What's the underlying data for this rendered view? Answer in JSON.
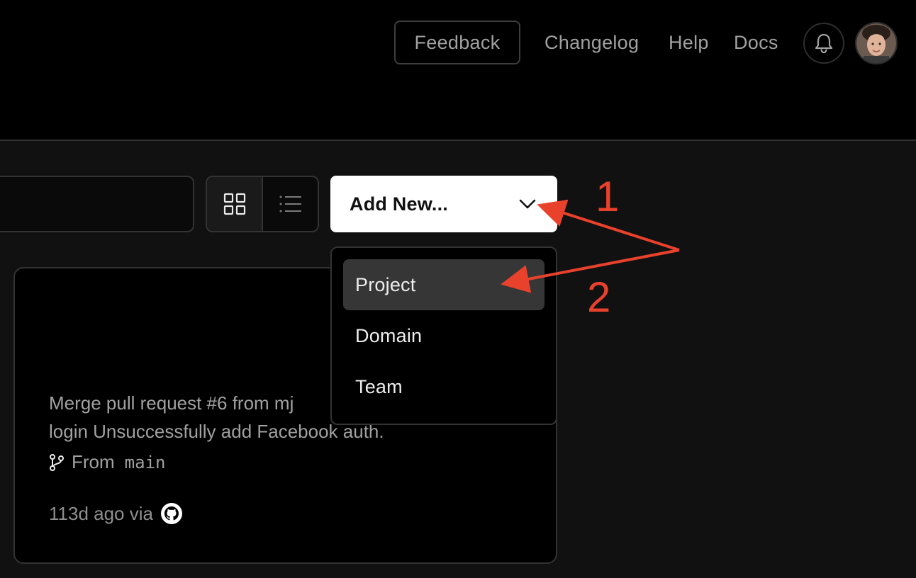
{
  "header": {
    "feedback_label": "Feedback",
    "nav_links": [
      "Changelog",
      "Help",
      "Docs"
    ],
    "notifications_icon": "bell-icon",
    "avatar_icon": "user-avatar"
  },
  "toolbar": {
    "view_toggle": [
      {
        "icon": "grid-icon",
        "active": true
      },
      {
        "icon": "list-icon",
        "active": false
      }
    ],
    "add_new_label": "Add New...",
    "add_new_icon": "chevron-down-icon"
  },
  "dropdown": {
    "items": [
      {
        "label": "Project",
        "highlighted": true
      },
      {
        "label": "Domain",
        "highlighted": false
      },
      {
        "label": "Team",
        "highlighted": false
      }
    ]
  },
  "project_card": {
    "commit_line1": "Merge pull request #6 from mj",
    "commit_line2": "login Unsuccessfully add Facebook auth.",
    "branch_prefix": "From",
    "branch": "main",
    "time_text": "113d ago via",
    "source_icon": "github-icon"
  },
  "annotations": {
    "label_1": "1",
    "label_2": "2",
    "color": "#e8412c"
  },
  "colors": {
    "header_bg": "#000000",
    "page_bg": "#111111",
    "accent_white": "#ffffff",
    "menu_highlight": "#363636",
    "annotation_red": "#e8412c"
  }
}
